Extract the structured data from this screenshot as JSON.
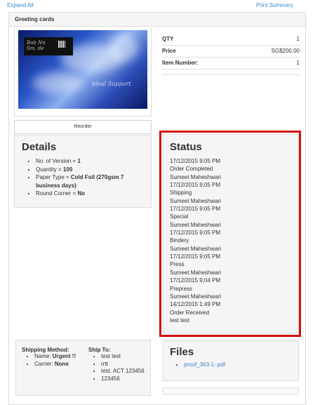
{
  "top_links": {
    "expand_all": "Expand All",
    "print_summary": "Print Summary"
  },
  "panel": {
    "title": "Greeting cards"
  },
  "product_image": {
    "text_lines": [
      "Bob Nn",
      "Sm. de",
      "Ideal Support"
    ],
    "colors": {
      "dark": "#0b1a6b",
      "mid": "#2a56c8",
      "light": "#8db0f0"
    }
  },
  "info": {
    "qty_label": "QTY",
    "qty_value": "1",
    "price_label": "Price",
    "price_value": "SG$200.00",
    "item_label": "Item Number:",
    "item_value": "1"
  },
  "reorder_label": "Reorder",
  "details": {
    "title": "Details",
    "items": [
      {
        "label": "No. of Version = ",
        "value": "1"
      },
      {
        "label": "Quantity = ",
        "value": "100"
      },
      {
        "label": "Paper Type = ",
        "value": "Cold Foil (270gsm 7 business days)"
      },
      {
        "label": "Round Corner = ",
        "value": "No"
      }
    ]
  },
  "status": {
    "title": "Status",
    "lines": [
      "17/12/2015 9:05 PM",
      "Order Completed",
      "Sumeet Maheshwari",
      "17/12/2015 9:05 PM",
      "Shipping",
      "Sumeet Maheshwari",
      "17/12/2015 9:05 PM",
      "Special",
      "Sumeet Maheshwari",
      "17/12/2015 9:05 PM",
      "Bindery",
      "Sumeet Maheshwari",
      "17/12/2015 9:05 PM",
      "Press",
      "Sumeet Maheshwari",
      "17/12/2015 9:04 PM",
      "Prepress",
      "Sumeet Maheshwari",
      "14/12/2015 1:49 PM",
      "Order Received",
      "test test"
    ],
    "highlight_color": "#d01010"
  },
  "shipping": {
    "method_title": "Shipping Method:",
    "method_items": [
      {
        "label": "Name: ",
        "value": "Urgent !!"
      },
      {
        "label": "Carrier: ",
        "value": "None"
      }
    ],
    "to_title": "Ship To:",
    "to_items": [
      "test test",
      "rrtt",
      "test, ACT 123456",
      "123456"
    ]
  },
  "files": {
    "title": "Files",
    "items": [
      "proof_363-1-.pdf"
    ]
  }
}
